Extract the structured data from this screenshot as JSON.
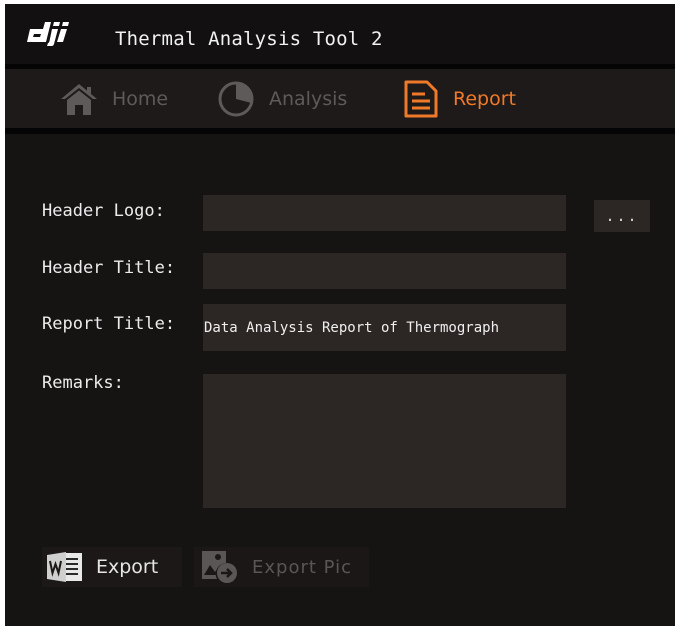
{
  "app": {
    "logo_text": "dji",
    "title": "Thermal Analysis Tool 2"
  },
  "nav": {
    "tabs": [
      {
        "label": "Home",
        "icon": "home-icon",
        "active": false
      },
      {
        "label": "Analysis",
        "icon": "pie-chart-icon",
        "active": false
      },
      {
        "label": "Report",
        "icon": "report-document-icon",
        "active": true
      }
    ]
  },
  "form": {
    "header_logo": {
      "label": "Header Logo:",
      "value": "",
      "browse_label": "..."
    },
    "header_title": {
      "label": "Header Title:",
      "value": ""
    },
    "report_title": {
      "label": "Report Title:",
      "value": "Data Analysis Report of Thermograph"
    },
    "remarks": {
      "label": "Remarks:",
      "value": ""
    }
  },
  "actions": {
    "export": {
      "label": "Export",
      "icon": "word-document-icon"
    },
    "export_pic": {
      "label": "Export Pic",
      "icon": "export-picture-icon"
    }
  },
  "colors": {
    "accent": "#f07a2a",
    "background": "#161313",
    "field": "#2c2624",
    "inactive_tab": "#5e5a5a"
  }
}
